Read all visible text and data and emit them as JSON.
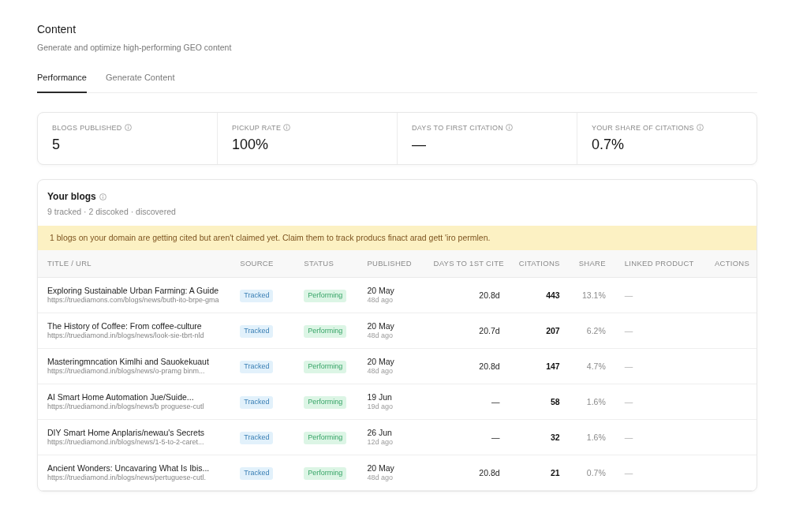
{
  "page": {
    "title": "Content",
    "subtitle": "Generate and optimize high-performing GEO content"
  },
  "tabs": [
    {
      "label": "Performance",
      "selected": true
    },
    {
      "label": "Generate Content",
      "selected": false
    }
  ],
  "stats": [
    {
      "label": "BLOGS PUBLISHED",
      "value": "5"
    },
    {
      "label": "PICKUP RATE",
      "value": "100%"
    },
    {
      "label": "DAYS TO FIRST CITATION",
      "value": "—"
    },
    {
      "label": "YOUR SHARE OF CITATIONS",
      "value": "0.7%"
    }
  ],
  "blogs": {
    "title": "Your blogs",
    "subtitle": "9 tracked · 2 discoked · discovered",
    "alert": "1 blogs on your domain are getting cited but aren't claimed yet. Claim them to track producs finact arad gett 'iro permlen.",
    "table": {
      "columns": [
        "TITLE / URL",
        "SOURCE",
        "STATUS",
        "PUBLISHED",
        "DAYS TO 1ST CITE",
        "CITATIONS",
        "SHARE",
        "LINKED PRODUCT",
        "ACTIONS"
      ],
      "rows": [
        {
          "title": "Exploring Sustainable Urban Farming: A Guide",
          "url": "https://truediamons.com/blogs/news/buth-ito-brpe-gma",
          "source": "Tracked",
          "status": "Performing",
          "published": "20 May",
          "published_ago": "48d ago",
          "days_to_first_cite": "20.8d",
          "citations": "443",
          "share": "13.1%",
          "linked_product": "—"
        },
        {
          "title": "The History of Coffee: From coffee-culture",
          "url": "https://truediamond.in/blogs/news/look-sie-tbrt-nld",
          "source": "Tracked",
          "status": "Performing",
          "published": "20 May",
          "published_ago": "48d ago",
          "days_to_first_cite": "20.7d",
          "citations": "207",
          "share": "6.2%",
          "linked_product": "—"
        },
        {
          "title": "Masteringmncation Kimlhi and Sauokekuaut",
          "url": "https://truediamond.in/blogs/news/o-pramg binm...",
          "source": "Tracked",
          "status": "Performing",
          "published": "20 May",
          "published_ago": "48d ago",
          "days_to_first_cite": "20.8d",
          "citations": "147",
          "share": "4.7%",
          "linked_product": "—"
        },
        {
          "title": "AI Smart Home Automation Jue/Suide...",
          "url": "https://truediamond.in/blogs/news/b proguese-cutl",
          "source": "Tracked",
          "status": "Performing",
          "published": "19 Jun",
          "published_ago": "19d ago",
          "days_to_first_cite": "—",
          "citations": "58",
          "share": "1.6%",
          "linked_product": "—"
        },
        {
          "title": "DIY Smart Home Anplaris/newau's Secrets",
          "url": "https://truediamond.in/blogs/news/1-5-to-2-caret...",
          "source": "Tracked",
          "status": "Performing",
          "published": "26 Jun",
          "published_ago": "12d ago",
          "days_to_first_cite": "—",
          "citations": "32",
          "share": "1.6%",
          "linked_product": "—"
        },
        {
          "title": "Ancient Wonders: Uncavaring What Is Ibis...",
          "url": "https://truediamond.in/blogs/news/pertuguese-cutl.",
          "source": "Tracked",
          "status": "Performing",
          "published": "20 May",
          "published_ago": "48d ago",
          "days_to_first_cite": "20.8d",
          "citations": "21",
          "share": "0.7%",
          "linked_product": "—"
        }
      ]
    }
  }
}
